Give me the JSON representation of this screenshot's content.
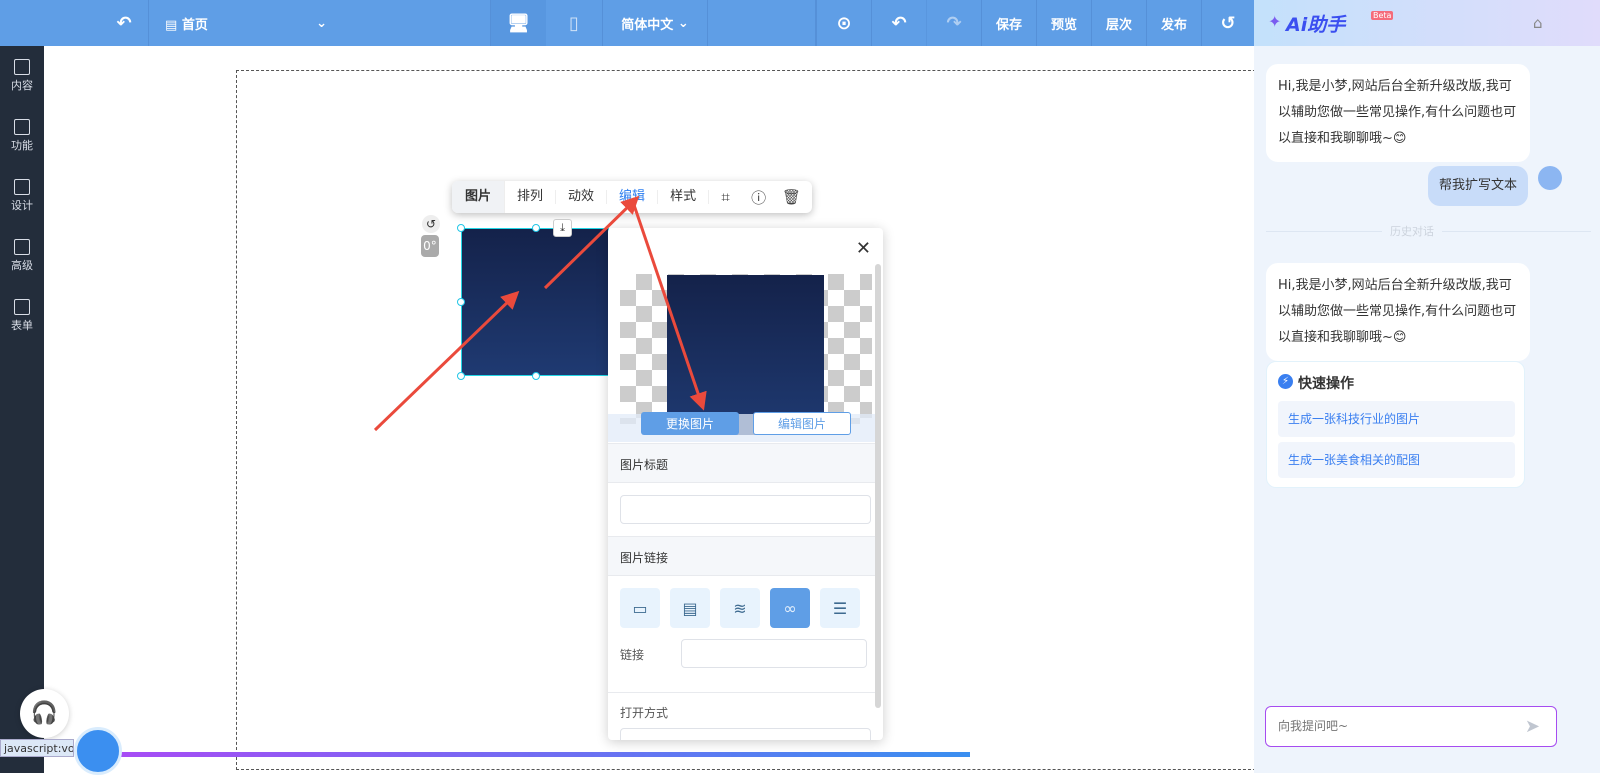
{
  "topbar": {
    "undo_icon": "undo-icon",
    "page_select": "首页",
    "device_desktop": "desktop-icon",
    "device_mobile": "mobile-icon",
    "language": "简体中文",
    "more_icon": "more-icon",
    "undo": "undo-icon",
    "redo": "redo-icon",
    "save": "保存",
    "preview": "预览",
    "layers": "层次",
    "publish": "发布",
    "history_icon": "history-icon"
  },
  "sidebar": {
    "items": [
      {
        "label": "内容"
      },
      {
        "label": "功能"
      },
      {
        "label": "设计"
      },
      {
        "label": "高级"
      },
      {
        "label": "表单"
      }
    ]
  },
  "float_toolbar": {
    "tabs": [
      "图片",
      "排列",
      "动效",
      "编辑",
      "样式"
    ],
    "active": "编辑",
    "icons": [
      "crop-icon",
      "help-icon",
      "delete-icon"
    ]
  },
  "image": {
    "rotation": "0°"
  },
  "panel": {
    "replace_btn": "更换图片",
    "edit_btn": "编辑图片",
    "title_section": "图片标题",
    "title_value": "",
    "link_section": "图片链接",
    "link_label": "链接",
    "link_value": "",
    "open_section": "打开方式",
    "link_types": [
      "page-icon",
      "note-icon",
      "layers-icon",
      "link-icon",
      "list-icon"
    ],
    "active_link_type": 3
  },
  "ai": {
    "title": "Ai助手",
    "badge": "Beta",
    "greeting": "Hi,我是小梦,网站后台全新升级改版,我可以辅助您做一些常见操作,有什么问题也可以直接和我聊聊哦~😊",
    "user_msg": "帮我扩写文本",
    "history_divider": "历史对话",
    "greeting2": "Hi,我是小梦,网站后台全新升级改版,我可以辅助您做一些常见操作,有什么问题也可以直接和我聊聊哦~😊",
    "quick_title": "快速操作",
    "quick_items": [
      "生成一张科技行业的图片",
      "生成一张美食相关的配图"
    ],
    "input_placeholder": "向我提问吧~"
  },
  "statusbar": {
    "url": "javascript:vo"
  }
}
